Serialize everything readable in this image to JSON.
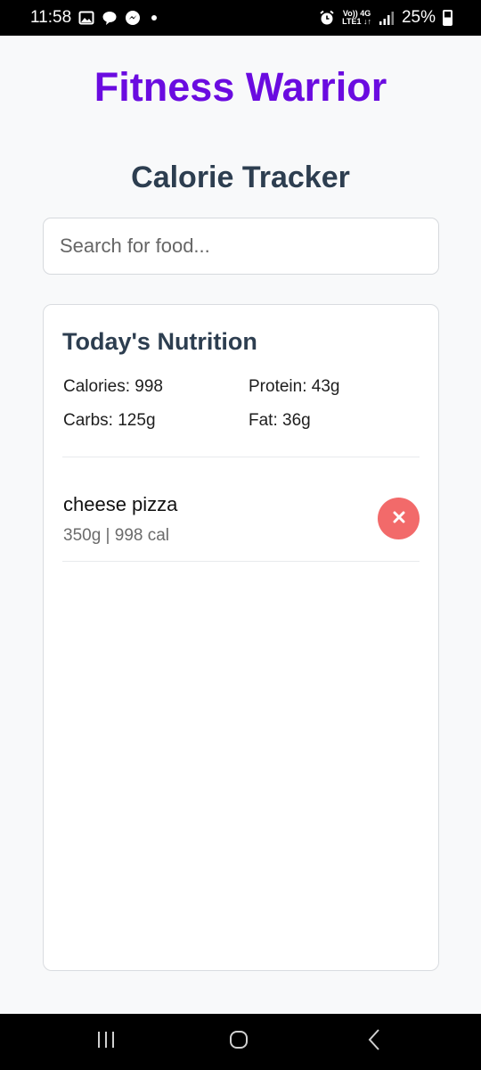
{
  "status_bar": {
    "time": "11:58",
    "network_top": "Vo)) 4G",
    "network_bottom": "LTE1 ↓↑",
    "battery_percent": "25%",
    "battery_level": 0.25,
    "icons": [
      "image-icon",
      "chat-bubble-icon",
      "messenger-icon",
      "notification-dot-icon",
      "alarm-icon",
      "signal-icon",
      "battery-icon"
    ]
  },
  "header": {
    "app_title": "Fitness Warrior",
    "page_title": "Calorie Tracker"
  },
  "search": {
    "placeholder": "Search for food...",
    "value": ""
  },
  "nutrition": {
    "title": "Today's Nutrition",
    "calories": "Calories: 998",
    "protein": "Protein: 43g",
    "carbs": "Carbs: 125g",
    "fat": "Fat: 36g"
  },
  "food_items": [
    {
      "name": "cheese pizza",
      "detail": "350g | 998 cal",
      "remove_icon": "close-icon"
    }
  ],
  "colors": {
    "brand_purple": "#6a0be0",
    "heading": "#2d3e50",
    "remove_red": "#f26a6a",
    "background": "#f8f9fa"
  },
  "nav_bar": {
    "icons": [
      "recents-icon",
      "home-icon",
      "back-icon"
    ]
  }
}
